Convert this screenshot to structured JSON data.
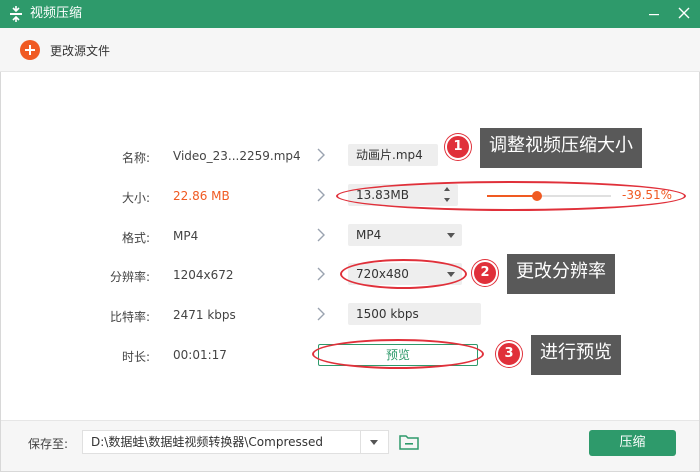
{
  "window": {
    "title": "视频压缩",
    "app_icon": "compress-icon",
    "minimize_icon": "minimize-icon",
    "close_icon": "close-icon"
  },
  "toolbar": {
    "change_source_label": "更改源文件",
    "change_source_icon": "plus-circle-icon"
  },
  "rows": {
    "name": {
      "label": "名称:",
      "original": "Video_23...2259.mp4",
      "output": "动画片.mp4"
    },
    "size": {
      "label": "大小:",
      "original": "22.86 MB",
      "output": "13.83MB",
      "percent": "-39.51%",
      "slider_fraction": 0.4
    },
    "format": {
      "label": "格式:",
      "original": "MP4",
      "output": "MP4"
    },
    "resolution": {
      "label": "分辨率:",
      "original": "1204x672",
      "output": "720x480"
    },
    "bitrate": {
      "label": "比特率:",
      "original": "2471 kbps",
      "output": "1500 kbps"
    },
    "duration": {
      "label": "时长:",
      "original": "00:01:17",
      "preview_label": "预览"
    }
  },
  "annotations": [
    {
      "number": "1",
      "text": "调整视频压缩大小"
    },
    {
      "number": "2",
      "text": "更改分辨率"
    },
    {
      "number": "3",
      "text": "进行预览"
    }
  ],
  "bottom": {
    "save_label": "保存至:",
    "save_path": "D:\\数据蛙\\数据蛙视频转换器\\Compressed",
    "folder_icon": "folder-icon",
    "compress_label": "压缩"
  },
  "colors": {
    "accent_green": "#2e9a6b",
    "accent_orange": "#f05a22",
    "annotation_red": "#e0303a",
    "callout_gray": "#595959"
  }
}
